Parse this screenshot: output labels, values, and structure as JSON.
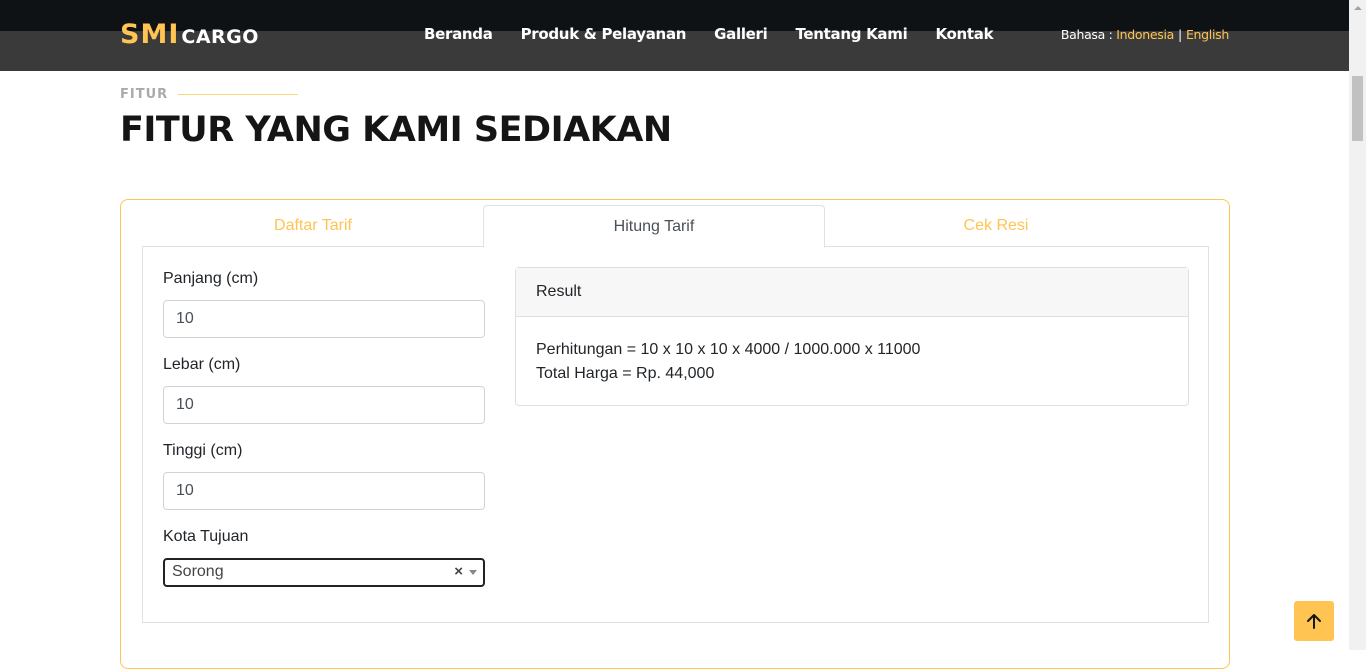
{
  "brand": {
    "name_part1": "SMI",
    "name_part2": "CARGO"
  },
  "nav": {
    "items": [
      {
        "label": "Beranda"
      },
      {
        "label": "Produk & Pelayanan"
      },
      {
        "label": "Galleri"
      },
      {
        "label": "Tentang Kami"
      },
      {
        "label": "Kontak"
      }
    ]
  },
  "language": {
    "prefix": "Bahasa :",
    "option1": "Indonesia",
    "separator": "|",
    "option2": "English"
  },
  "section": {
    "eyebrow": "FITUR",
    "title": "FITUR YANG KAMI SEDIAKAN"
  },
  "tabs": [
    {
      "label": "Daftar Tarif",
      "active": false
    },
    {
      "label": "Hitung Tarif",
      "active": true
    },
    {
      "label": "Cek Resi",
      "active": false
    }
  ],
  "form": {
    "length_label": "Panjang (cm)",
    "length_value": "10",
    "width_label": "Lebar (cm)",
    "width_value": "10",
    "height_label": "Tinggi (cm)",
    "height_value": "10",
    "city_label": "Kota Tujuan",
    "city_value": "Sorong",
    "clear_symbol": "×"
  },
  "result": {
    "header": "Result",
    "calculation": "Perhitungan = 10 x 10 x 10 x 4000 / 1000.000 x 11000",
    "total": "Total Harga = Rp. 44,000"
  },
  "colors": {
    "accent": "#ffc451",
    "header_bg": "#3a3a3a",
    "header_top": "#0f1214"
  },
  "icons": {
    "back_to_top": "arrow-up-icon",
    "select_arrow": "chevron-down-icon"
  }
}
